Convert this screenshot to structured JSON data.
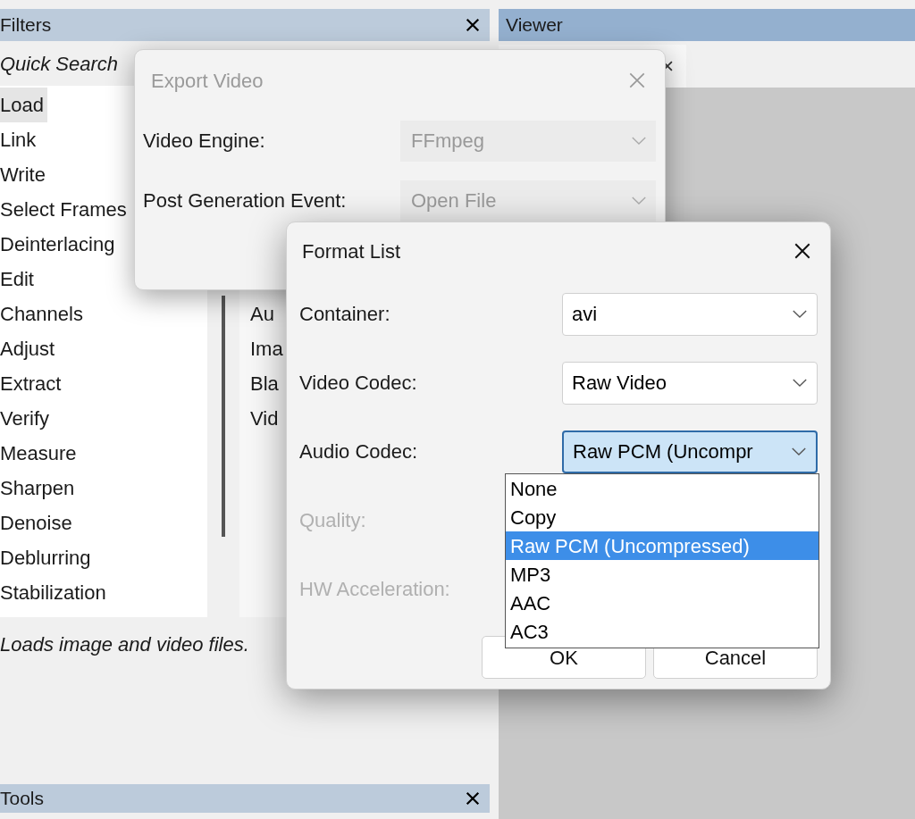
{
  "filters_panel": {
    "title": "Filters",
    "search_label": "Quick Search",
    "items": [
      {
        "label": "Load",
        "selected": true
      },
      {
        "label": "Link",
        "selected": false
      },
      {
        "label": "Write",
        "selected": false
      },
      {
        "label": "Select Frames",
        "selected": false
      },
      {
        "label": "Deinterlacing",
        "selected": false
      },
      {
        "label": "Edit",
        "selected": false
      },
      {
        "label": "Channels",
        "selected": false
      },
      {
        "label": "Adjust",
        "selected": false
      },
      {
        "label": "Extract",
        "selected": false
      },
      {
        "label": "Verify",
        "selected": false
      },
      {
        "label": "Measure",
        "selected": false
      },
      {
        "label": "Sharpen",
        "selected": false
      },
      {
        "label": "Denoise",
        "selected": false
      },
      {
        "label": "Deblurring",
        "selected": false
      },
      {
        "label": "Stabilization",
        "selected": false
      }
    ],
    "sub_items": [
      "Au",
      "Ima",
      "Bla",
      "Vid"
    ],
    "description": "Loads image and video files."
  },
  "viewer_panel": {
    "title": "Viewer"
  },
  "tools_panel": {
    "title": "Tools"
  },
  "export_dialog": {
    "title": "Export Video",
    "fields": [
      {
        "label": "Video Engine:",
        "value": "FFmpeg",
        "disabled": true
      },
      {
        "label": "Post Generation Event:",
        "value": "Open File",
        "disabled": true
      }
    ]
  },
  "format_dialog": {
    "title": "Format List",
    "fields": [
      {
        "kind": "combo",
        "label": "Container:",
        "value": "avi",
        "disabled": false,
        "focused": false
      },
      {
        "kind": "combo",
        "label": "Video Codec:",
        "value": "Raw Video",
        "disabled": false,
        "focused": false
      },
      {
        "kind": "combo",
        "label": "Audio Codec:",
        "value": "Raw PCM (Uncompr",
        "disabled": false,
        "focused": true
      },
      {
        "kind": "label",
        "label": "Quality:",
        "disabled": true
      },
      {
        "kind": "label",
        "label": "HW Acceleration:",
        "disabled": true
      }
    ],
    "buttons": [
      "OK",
      "Cancel"
    ],
    "dropdown": [
      {
        "label": "None",
        "selected": false
      },
      {
        "label": "Copy",
        "selected": false
      },
      {
        "label": "Raw PCM (Uncompressed)",
        "selected": true
      },
      {
        "label": "MP3",
        "selected": false
      },
      {
        "label": "AAC",
        "selected": false
      },
      {
        "label": "AC3",
        "selected": false
      }
    ]
  }
}
